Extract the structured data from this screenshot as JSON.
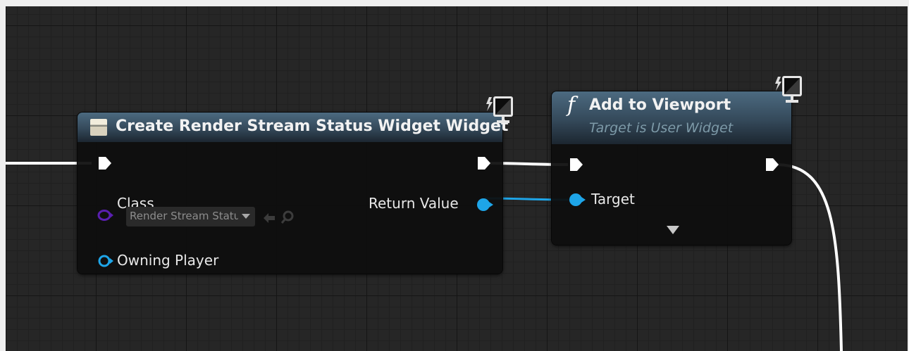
{
  "graph": {
    "create_widget_node": {
      "title": "Create Render Stream Status Widget Widget",
      "icon": "widget-class-icon",
      "pins": {
        "class_label": "Class",
        "class_value": "Render Stream Status Widget",
        "owning_player_label": "Owning Player",
        "return_value_label": "Return Value"
      },
      "server_client_icon": "monitor-icon"
    },
    "add_to_viewport_node": {
      "title": "Add to Viewport",
      "subtitle": "Target is User Widget",
      "icon": "function-icon",
      "icon_glyph": "f",
      "pins": {
        "target_label": "Target"
      },
      "server_client_icon": "monitor-icon",
      "advanced_pins_icon": "expand-arrow-icon"
    }
  },
  "colors": {
    "canvas_bg": "#262626",
    "exec_wire": "#ffffff",
    "object_pin": "#1ea5e8",
    "class_pin": "#5a1fb0"
  }
}
